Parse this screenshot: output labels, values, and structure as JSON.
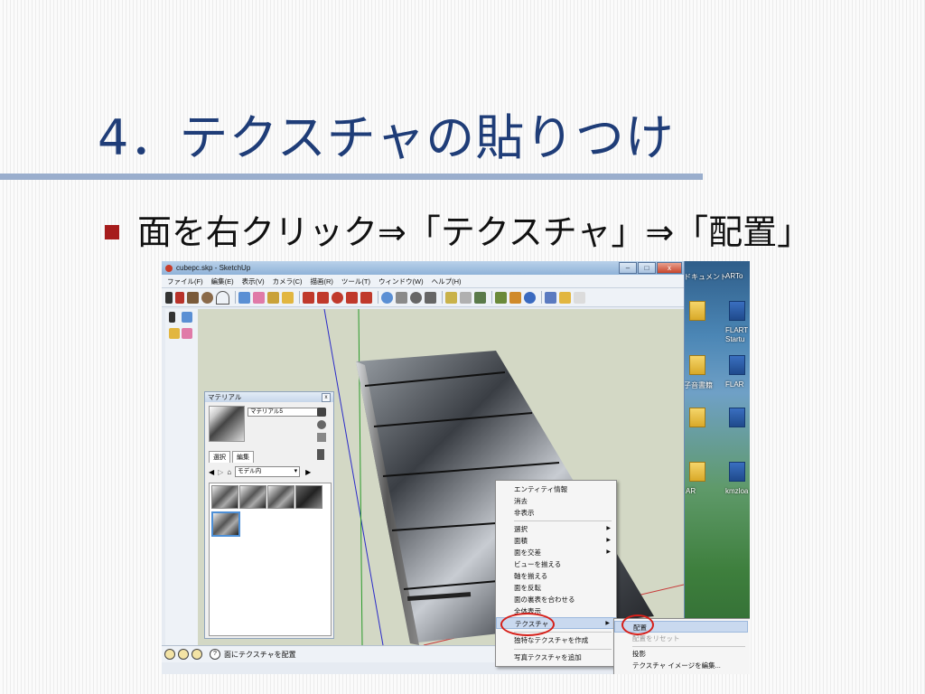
{
  "slide": {
    "title": "4．テクスチャの貼りつけ",
    "bullet": "面を右クリック⇒「テクスチャ」⇒「配置」"
  },
  "window": {
    "title": "cubepc.skp - SketchUp",
    "buttons": [
      "–",
      "□",
      "x"
    ]
  },
  "menubar": [
    "ファイル(F)",
    "編集(E)",
    "表示(V)",
    "カメラ(C)",
    "描画(R)",
    "ツール(T)",
    "ウィンドウ(W)",
    "ヘルプ(H)"
  ],
  "material_panel": {
    "title": "マテリアル",
    "close": "x",
    "name": "マテリアル5",
    "tabs": [
      "選択",
      "編集"
    ],
    "collection": "モデル内"
  },
  "context_menu": {
    "items": [
      "エンティティ情報",
      "消去",
      "非表示",
      "選択",
      "面積",
      "面を交差",
      "ビューを揃える",
      "軸を揃える",
      "面を反転",
      "面の裏表を合わせる",
      "全体表示",
      "テクスチャ",
      "独特なテクスチャを作成",
      "写真テクスチャを追加"
    ],
    "submenu_arrows": [
      "選択",
      "面積",
      "面を交差",
      "テクスチャ"
    ]
  },
  "sub_menu": {
    "items": [
      "配置",
      "配置をリセット",
      "投影",
      "テクスチャ イメージを編集..."
    ]
  },
  "statusbar": {
    "help": "?",
    "text": "面にテクスチャを配置"
  },
  "desktop": {
    "labels": [
      "ドキュメント",
      "ARTo",
      "FLART",
      "Startu",
      "子音書籍",
      "FLAR",
      "AR",
      "kmzloa"
    ]
  },
  "colors": {
    "title": "#1f3d78",
    "rule": "#9aaecd",
    "bullet": "#a61c1c",
    "highlight_oval": "#d6201a"
  }
}
